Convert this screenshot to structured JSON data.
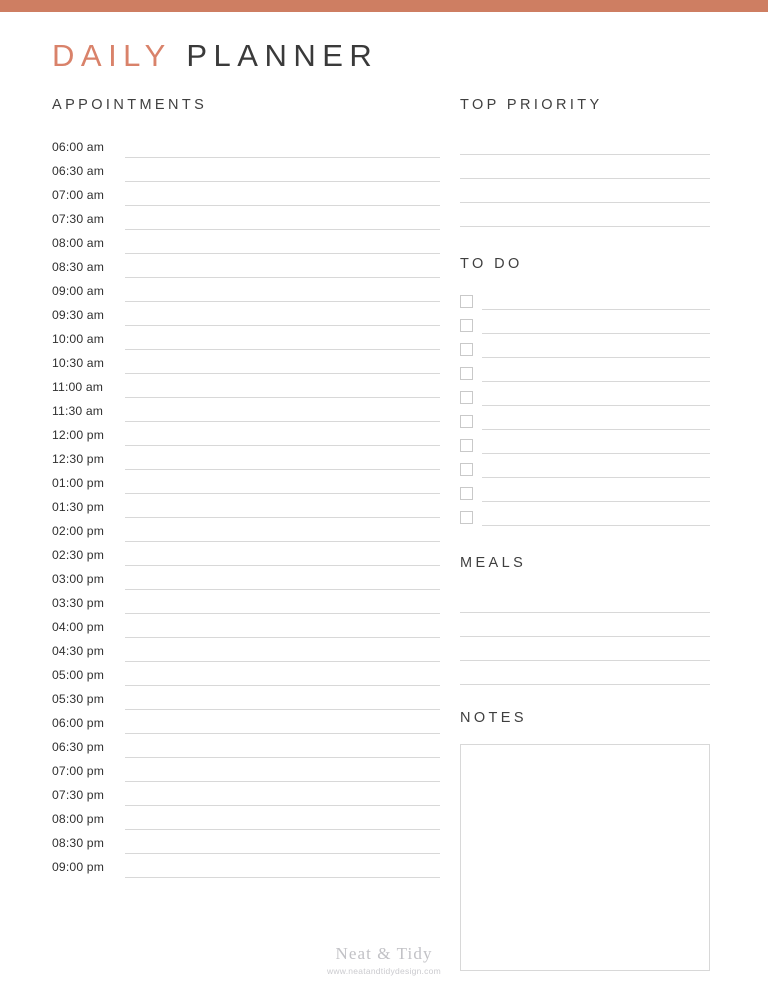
{
  "theme": {
    "accent_color": "#ce7e62",
    "title_accent_color": "#d9826a",
    "title_color": "#3a3a3a",
    "rule_color": "#d8d8d8",
    "checkbox_border_color": "#c9c9c9",
    "footer_color": "#c2c2c6"
  },
  "masthead": {
    "word_accent": "DAILY",
    "word_plain": "PLANNER"
  },
  "appointments": {
    "heading": "APPOINTMENTS",
    "times": [
      "06:00 am",
      "06:30 am",
      "07:00 am",
      "07:30 am",
      "08:00 am",
      "08:30 am",
      "09:00 am",
      "09:30 am",
      "10:00 am",
      "10:30 am",
      "11:00 am",
      "11:30 am",
      "12:00 pm",
      "12:30 pm",
      "01:00 pm",
      "01:30 pm",
      "02:00 pm",
      "02:30 pm",
      "03:00 pm",
      "03:30 pm",
      "04:00 pm",
      "04:30 pm",
      "05:00 pm",
      "05:30 pm",
      "06:00 pm",
      "06:30 pm",
      "07:00 pm",
      "07:30 pm",
      "08:00 pm",
      "08:30 pm",
      "09:00 pm"
    ],
    "entries": [
      "",
      "",
      "",
      "",
      "",
      "",
      "",
      "",
      "",
      "",
      "",
      "",
      "",
      "",
      "",
      "",
      "",
      "",
      "",
      "",
      "",
      "",
      "",
      "",
      "",
      "",
      "",
      "",
      "",
      "",
      ""
    ]
  },
  "top_priority": {
    "heading": "TOP PRIORITY",
    "line_count": 4,
    "entries": [
      "",
      "",
      "",
      ""
    ]
  },
  "todo": {
    "heading": "TO DO",
    "item_count": 10,
    "items": [
      {
        "checked": false,
        "text": ""
      },
      {
        "checked": false,
        "text": ""
      },
      {
        "checked": false,
        "text": ""
      },
      {
        "checked": false,
        "text": ""
      },
      {
        "checked": false,
        "text": ""
      },
      {
        "checked": false,
        "text": ""
      },
      {
        "checked": false,
        "text": ""
      },
      {
        "checked": false,
        "text": ""
      },
      {
        "checked": false,
        "text": ""
      },
      {
        "checked": false,
        "text": ""
      }
    ]
  },
  "meals": {
    "heading": "MEALS",
    "line_count": 4,
    "entries": [
      "",
      "",
      "",
      ""
    ]
  },
  "notes": {
    "heading": "NOTES",
    "content": ""
  },
  "footer": {
    "brand": "Neat & Tidy",
    "url": "www.neatandtidydesign.com"
  }
}
